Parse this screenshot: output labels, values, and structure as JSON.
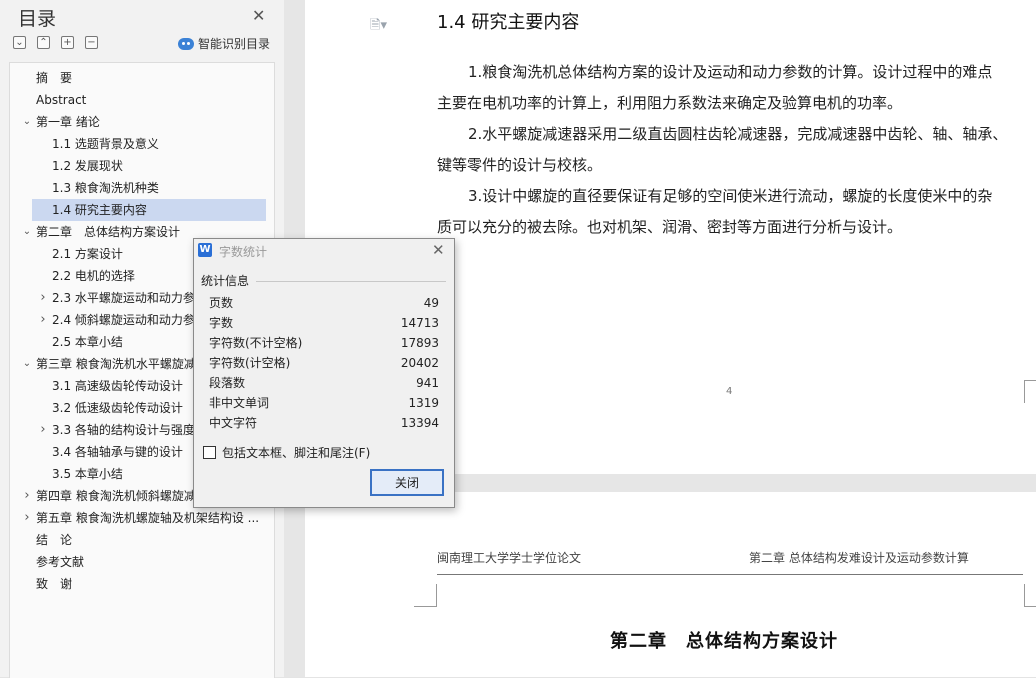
{
  "sidebar": {
    "title": "目录",
    "smart_label": "智能识别目录",
    "items": [
      {
        "label": "摘　要",
        "level": 0,
        "expand": ""
      },
      {
        "label": "Abstract",
        "level": 0,
        "expand": ""
      },
      {
        "label": "第一章  绪论",
        "level": 0,
        "expand": "open"
      },
      {
        "label": "1.1 选题背景及意义",
        "level": 1,
        "expand": ""
      },
      {
        "label": "1.2 发展现状",
        "level": 1,
        "expand": ""
      },
      {
        "label": "1.3 粮食淘洗机种类",
        "level": 1,
        "expand": ""
      },
      {
        "label": "1.4 研究主要内容",
        "level": 1,
        "expand": "",
        "selected": true
      },
      {
        "label": "第二章　总体结构方案设计",
        "level": 0,
        "expand": "open"
      },
      {
        "label": "2.1 方案设计",
        "level": 1,
        "expand": ""
      },
      {
        "label": "2.2 电机的选择",
        "level": 1,
        "expand": ""
      },
      {
        "label": "2.3 水平螺旋运动和动力参数",
        "level": 1,
        "expand": "closed"
      },
      {
        "label": "2.4 倾斜螺旋运动和动力参数",
        "level": 1,
        "expand": "closed"
      },
      {
        "label": "2.5 本章小结",
        "level": 1,
        "expand": ""
      },
      {
        "label": "第三章  粮食淘洗机水平螺旋减速器",
        "level": 0,
        "expand": "open"
      },
      {
        "label": "3.1 高速级齿轮传动设计",
        "level": 1,
        "expand": ""
      },
      {
        "label": "3.2 低速级齿轮传动设计",
        "level": 1,
        "expand": ""
      },
      {
        "label": "3.3  各轴的结构设计与强度校核",
        "level": 1,
        "expand": "closed"
      },
      {
        "label": "3.4 各轴轴承与键的设计",
        "level": 1,
        "expand": ""
      },
      {
        "label": "3.5 本章小结",
        "level": 1,
        "expand": ""
      },
      {
        "label": "第四章  粮食淘洗机倾斜螺旋减速器",
        "level": 0,
        "expand": "closed"
      },
      {
        "label": "第五章  粮食淘洗机螺旋轴及机架结构设 ...",
        "level": 0,
        "expand": "closed"
      },
      {
        "label": "结　论",
        "level": 0,
        "expand": ""
      },
      {
        "label": "参考文献",
        "level": 0,
        "expand": ""
      },
      {
        "label": "致　谢",
        "level": 0,
        "expand": ""
      }
    ]
  },
  "document": {
    "heading": "1.4 研究主要内容",
    "paragraphs": [
      "1.粮食淘洗机总体结构方案的设计及运动和动力参数的计算。设计过程中的难点",
      "主要在电机功率的计算上，利用阻力系数法来确定及验算电机的功率。",
      "2.水平螺旋减速器采用二级直齿圆柱齿轮减速器，完成减速器中齿轮、轴、轴承、",
      "键等零件的设计与校核。",
      "3.设计中螺旋的直径要保证有足够的空间使米进行流动，螺旋的长度使米中的杂",
      "质可以充分的被去除。也对机架、润滑、密封等方面进行分析与设计。"
    ],
    "page_number": "4",
    "header_left": "闽南理工大学学士学位论文",
    "header_right": "第二章  总体结构发难设计及运动参数计算",
    "chapter_title": "第二章　总体结构方案设计"
  },
  "dialog": {
    "icon_letter": "W",
    "title": "字数统计",
    "section": "统计信息",
    "stats": [
      {
        "label": "页数",
        "value": "49"
      },
      {
        "label": "字数",
        "value": "14713"
      },
      {
        "label": "字符数(不计空格)",
        "value": "17893"
      },
      {
        "label": "字符数(计空格)",
        "value": "20402"
      },
      {
        "label": "段落数",
        "value": "941"
      },
      {
        "label": "非中文单词",
        "value": "1319"
      },
      {
        "label": "中文字符",
        "value": "13394"
      }
    ],
    "checkbox_label": "包括文本框、脚注和尾注(F)",
    "checkbox_checked": false,
    "close_label": "关闭"
  },
  "colors": {
    "selection": "#cbd8f0",
    "accent": "#3a72c4",
    "sidebar_bg": "#f2f2f2"
  }
}
